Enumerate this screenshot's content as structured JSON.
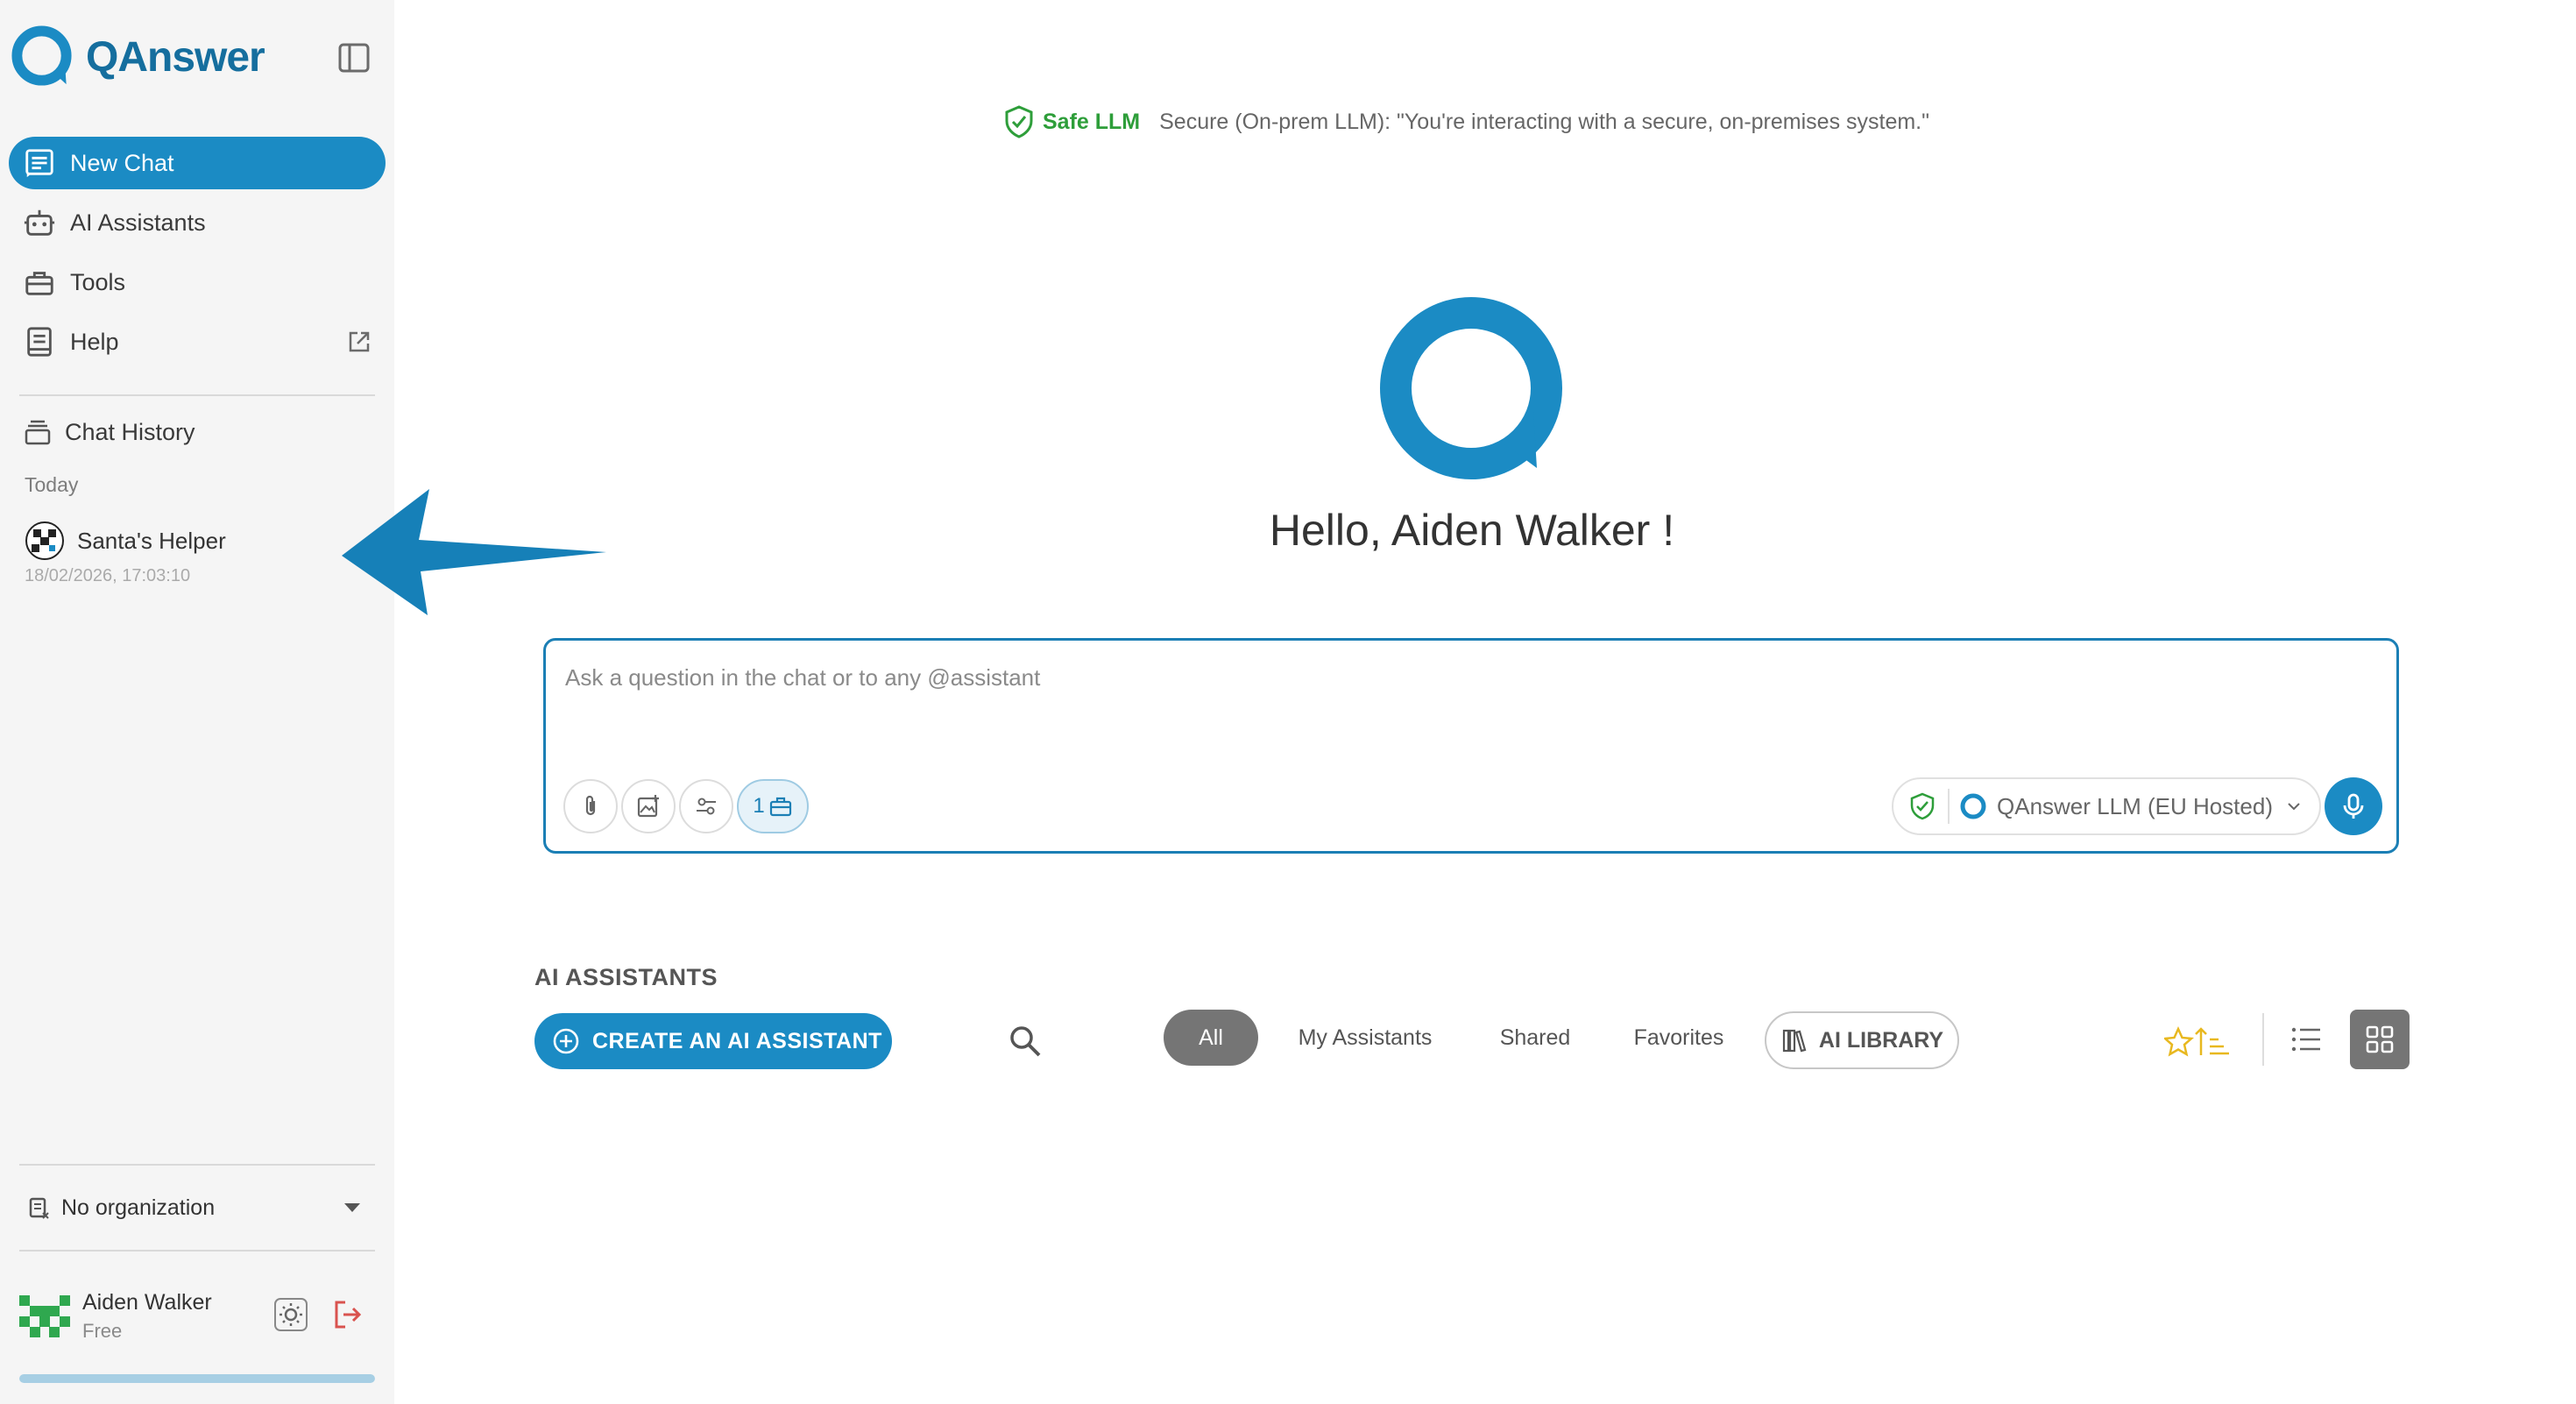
{
  "app": {
    "name": "QAnswer"
  },
  "colors": {
    "brand": "#1b8bc4",
    "safe": "#2e9e3a",
    "favorite": "#e8b81f",
    "danger": "#d9534f"
  },
  "sidebar": {
    "nav": [
      {
        "label": "New Chat",
        "icon": "chat-icon",
        "active": true
      },
      {
        "label": "AI Assistants",
        "icon": "robot-icon",
        "active": false
      },
      {
        "label": "Tools",
        "icon": "toolbox-icon",
        "active": false
      },
      {
        "label": "Help",
        "icon": "book-icon",
        "active": false,
        "external": true
      }
    ],
    "history": {
      "title": "Chat History",
      "group": "Today",
      "items": [
        {
          "name": "Santa's Helper",
          "date": "18/02/2026, 17:03:10"
        }
      ]
    },
    "organization": {
      "selected": "No organization"
    },
    "user": {
      "name": "Aiden Walker",
      "plan": "Free",
      "usage_fraction": 1.0
    }
  },
  "banner": {
    "label": "Safe LLM",
    "text": "Secure (On-prem LLM): \"You're interacting with a secure, on-premises system.\""
  },
  "greeting": "Hello, Aiden Walker !",
  "chat": {
    "placeholder": "Ask a question in the chat or to any @assistant",
    "tools_count": "1",
    "model": "QAnswer LLM (EU Hosted)"
  },
  "assistants": {
    "title": "AI ASSISTANTS",
    "create_label": "CREATE AN AI ASSISTANT",
    "filters": [
      "All",
      "My Assistants",
      "Shared",
      "Favorites"
    ],
    "selected_filter": "All",
    "library_label": "AI LIBRARY",
    "view_mode": "grid"
  }
}
